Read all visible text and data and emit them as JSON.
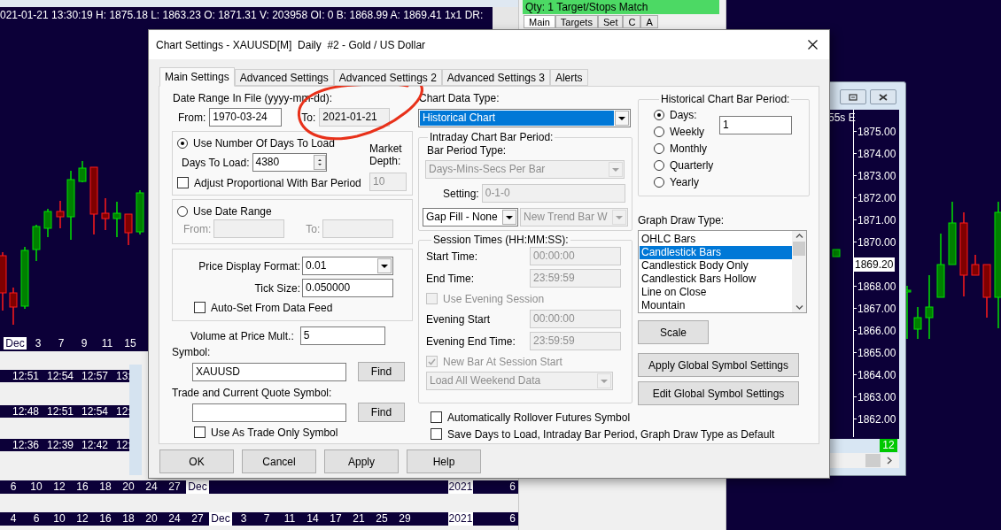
{
  "background": {
    "quote_line": "021-01-21 13:30:19 H: 1875.18 L: 1863.23 O: 1871.31 V: 203958 OI: 0 B: 1868.99 A: 1869.41 1x1 DR:",
    "left_chart_axis": [
      {
        "label": "Dec",
        "highlighted": true
      },
      {
        "label": "3",
        "highlighted": false
      },
      {
        "label": "7",
        "highlighted": false
      },
      {
        "label": "9",
        "highlighted": false
      },
      {
        "label": "11",
        "highlighted": false
      },
      {
        "label": "15",
        "highlighted": false
      }
    ],
    "time_strips": [
      [
        "12:51",
        "12:54",
        "12:57",
        "13:"
      ],
      [
        "12:48",
        "12:51",
        "12:54",
        "12:"
      ],
      [
        "12:36",
        "12:39",
        "12:42",
        "12:"
      ]
    ],
    "date_strips": [
      {
        "left": [
          {
            "label": "6",
            "highlighted": false
          },
          {
            "label": "10",
            "highlighted": false
          },
          {
            "label": "12",
            "highlighted": false
          },
          {
            "label": "16",
            "highlighted": false
          },
          {
            "label": "18",
            "highlighted": false
          },
          {
            "label": "20",
            "highlighted": false
          },
          {
            "label": "24",
            "highlighted": false
          },
          {
            "label": "27",
            "highlighted": false
          },
          {
            "label": "Dec",
            "highlighted": true
          }
        ],
        "right": [
          {
            "label": "2021",
            "highlighted": true
          },
          {
            "label": "6",
            "highlighted": false
          }
        ]
      },
      {
        "left": [
          {
            "label": "4",
            "highlighted": false
          },
          {
            "label": "6",
            "highlighted": false
          },
          {
            "label": "10",
            "highlighted": false
          },
          {
            "label": "12",
            "highlighted": false
          },
          {
            "label": "16",
            "highlighted": false
          },
          {
            "label": "18",
            "highlighted": false
          },
          {
            "label": "20",
            "highlighted": false
          },
          {
            "label": "24",
            "highlighted": false
          },
          {
            "label": "27",
            "highlighted": false
          },
          {
            "label": "Dec",
            "highlighted": true
          },
          {
            "label": "3",
            "highlighted": false
          },
          {
            "label": "7",
            "highlighted": false
          },
          {
            "label": "11",
            "highlighted": false
          },
          {
            "label": "14",
            "highlighted": false
          },
          {
            "label": "17",
            "highlighted": false
          },
          {
            "label": "21",
            "highlighted": false
          },
          {
            "label": "25",
            "highlighted": false
          },
          {
            "label": "29",
            "highlighted": false
          }
        ],
        "right": [
          {
            "label": "2021",
            "highlighted": true
          },
          {
            "label": "6",
            "highlighted": false
          }
        ]
      }
    ],
    "order_panel": {
      "status": "Qty: 1 Target/Stops Match",
      "tabs": [
        {
          "label": "Main",
          "selected": true
        },
        {
          "label": "Targets",
          "selected": false
        },
        {
          "label": "Set",
          "selected": false
        },
        {
          "label": "C",
          "selected": false
        },
        {
          "label": "A",
          "selected": false
        }
      ]
    },
    "right_chart": {
      "header": "55s E",
      "price_axis": [
        {
          "kind": "tick",
          "label": "1875.00"
        },
        {
          "kind": "tick",
          "label": "1874.00"
        },
        {
          "kind": "tick",
          "label": "1873.00"
        },
        {
          "kind": "tick",
          "label": "1872.00"
        },
        {
          "kind": "tick",
          "label": "1871.00"
        },
        {
          "kind": "tick",
          "label": "1870.00"
        },
        {
          "kind": "current",
          "label": "1869.20"
        },
        {
          "kind": "tick",
          "label": "1868.00"
        },
        {
          "kind": "tick",
          "label": "1867.00"
        },
        {
          "kind": "tick",
          "label": "1866.00"
        },
        {
          "kind": "tick",
          "label": "1865.00"
        },
        {
          "kind": "tick",
          "label": "1864.00"
        },
        {
          "kind": "tick",
          "label": "1863.00"
        },
        {
          "kind": "tick",
          "label": "1862.00"
        }
      ],
      "badge": "12"
    }
  },
  "dialog": {
    "title": "Chart Settings - XAUUSD[M]  Daily  #2 - Gold / US Dollar",
    "tabs": [
      {
        "label": "Main Settings",
        "selected": true
      },
      {
        "label": "Advanced Settings",
        "selected": false
      },
      {
        "label": "Advanced Settings 2",
        "selected": false
      },
      {
        "label": "Advanced Settings 3",
        "selected": false
      },
      {
        "label": "Alerts",
        "selected": false
      }
    ],
    "date_range": {
      "label": "Date Range In File (yyyy-mm-dd):",
      "from_label": "From:",
      "from": "1970-03-24",
      "to_label": "To:",
      "to": "2021-01-21"
    },
    "days_option": {
      "label": "Use Number Of Days To Load",
      "selected": true,
      "days_label": "Days To Load:",
      "days": "4380",
      "adjust_label": "Adjust Proportional With Bar Period",
      "adjust_checked": false,
      "market_depth_label": "Market Depth:",
      "market_depth": "10",
      "market_depth_disabled": true
    },
    "date_range_option": {
      "label": "Use Date Range",
      "selected": false,
      "from_label": "From:",
      "to_label": "To:"
    },
    "price": {
      "format_label": "Price Display Format:",
      "format": "0.01",
      "tick_label": "Tick Size:",
      "tick": "0.050000",
      "auto_label": "Auto-Set From Data Feed",
      "auto_checked": false
    },
    "volume": {
      "label": "Volume at Price Mult.:",
      "value": "5"
    },
    "symbol": {
      "label": "Symbol:",
      "value": "XAUUSD",
      "button": "Find"
    },
    "trade_symbol": {
      "label": "Trade and Current Quote Symbol:",
      "button": "Find",
      "trade_only_label": "Use As Trade Only Symbol",
      "trade_only_checked": false
    },
    "chart_data_type": {
      "label": "Chart Data Type:",
      "value": "Historical Chart"
    },
    "intraday": {
      "title": "Intraday Chart Bar Period:",
      "disabled": true,
      "type_label": "Bar Period Type:",
      "type": "Days-Mins-Secs Per Bar",
      "setting_label": "Setting:",
      "setting": "0-1-0",
      "gap_fill": "Gap Fill - None",
      "new_trend": "New Trend Bar W"
    },
    "session": {
      "title": "Session Times (HH:MM:SS):",
      "disabled": true,
      "rows": [
        {
          "kind": "time",
          "label": "Start Time:",
          "value": "00:00:00"
        },
        {
          "kind": "time",
          "label": "End Time:",
          "value": "23:59:59"
        },
        {
          "kind": "check",
          "label": "Use Evening Session",
          "checked": false
        },
        {
          "kind": "time",
          "label": "Evening Start",
          "value": "00:00:00"
        },
        {
          "kind": "time",
          "label": "Evening End Time:",
          "value": "23:59:59"
        },
        {
          "kind": "check",
          "label": "New Bar At Session Start",
          "checked": true
        },
        {
          "kind": "select",
          "value": "Load All Weekend Data"
        }
      ]
    },
    "options": [
      {
        "label": "Automatically Rollover Futures Symbol",
        "checked": false
      },
      {
        "label": "Save Days to Load, Intraday Bar Period, Graph Draw Type as Default",
        "checked": false
      }
    ],
    "historical_period": {
      "title": "Historical Chart Bar Period:",
      "days": "1",
      "options": [
        {
          "label": "Days:",
          "selected": true
        },
        {
          "label": "Weekly",
          "selected": false
        },
        {
          "label": "Monthly",
          "selected": false
        },
        {
          "label": "Quarterly",
          "selected": false
        },
        {
          "label": "Yearly",
          "selected": false
        }
      ]
    },
    "graph_draw_type": {
      "label": "Graph Draw Type:",
      "items": [
        {
          "label": "OHLC Bars",
          "selected": false
        },
        {
          "label": "Candlestick Bars",
          "selected": true
        },
        {
          "label": "Candlestick Body Only",
          "selected": false
        },
        {
          "label": "Candlestick Bars Hollow",
          "selected": false
        },
        {
          "label": "Line on Close",
          "selected": false
        },
        {
          "label": "Mountain",
          "selected": false
        }
      ]
    },
    "side_buttons": [
      "Scale",
      "Apply Global Symbol Settings",
      "Edit Global Symbol Settings"
    ],
    "buttons": [
      "OK",
      "Cancel",
      "Apply",
      "Help"
    ]
  }
}
